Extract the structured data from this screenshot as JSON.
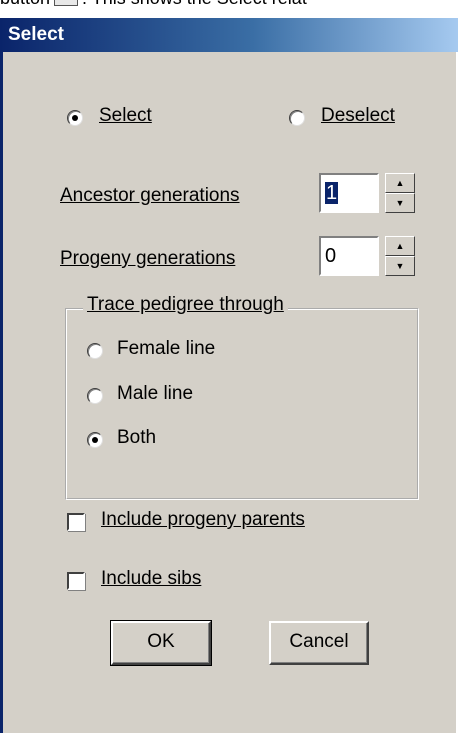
{
  "caption": {
    "before": "button",
    "after": ". This shows the Select relat"
  },
  "dialog": {
    "title": "Select",
    "mode": {
      "select_label": "Select",
      "deselect_label": "Deselect",
      "selected": "Select"
    },
    "ancestor": {
      "label": "Ancestor generations",
      "value": "1"
    },
    "progeny": {
      "label": "Progeny generations",
      "value": "0"
    },
    "trace": {
      "legend": "Trace pedigree through",
      "options": [
        "Female line",
        "Male line",
        "Both"
      ],
      "selected": "Both"
    },
    "include_progeny_parents": {
      "label": "Include progeny parents",
      "checked": false
    },
    "include_sibs": {
      "label": "Include sibs",
      "checked": false
    },
    "ok_label": "OK",
    "cancel_label": "Cancel"
  },
  "icons": {
    "spin_up": "spin-up-arrow",
    "spin_down": "spin-down-arrow"
  }
}
